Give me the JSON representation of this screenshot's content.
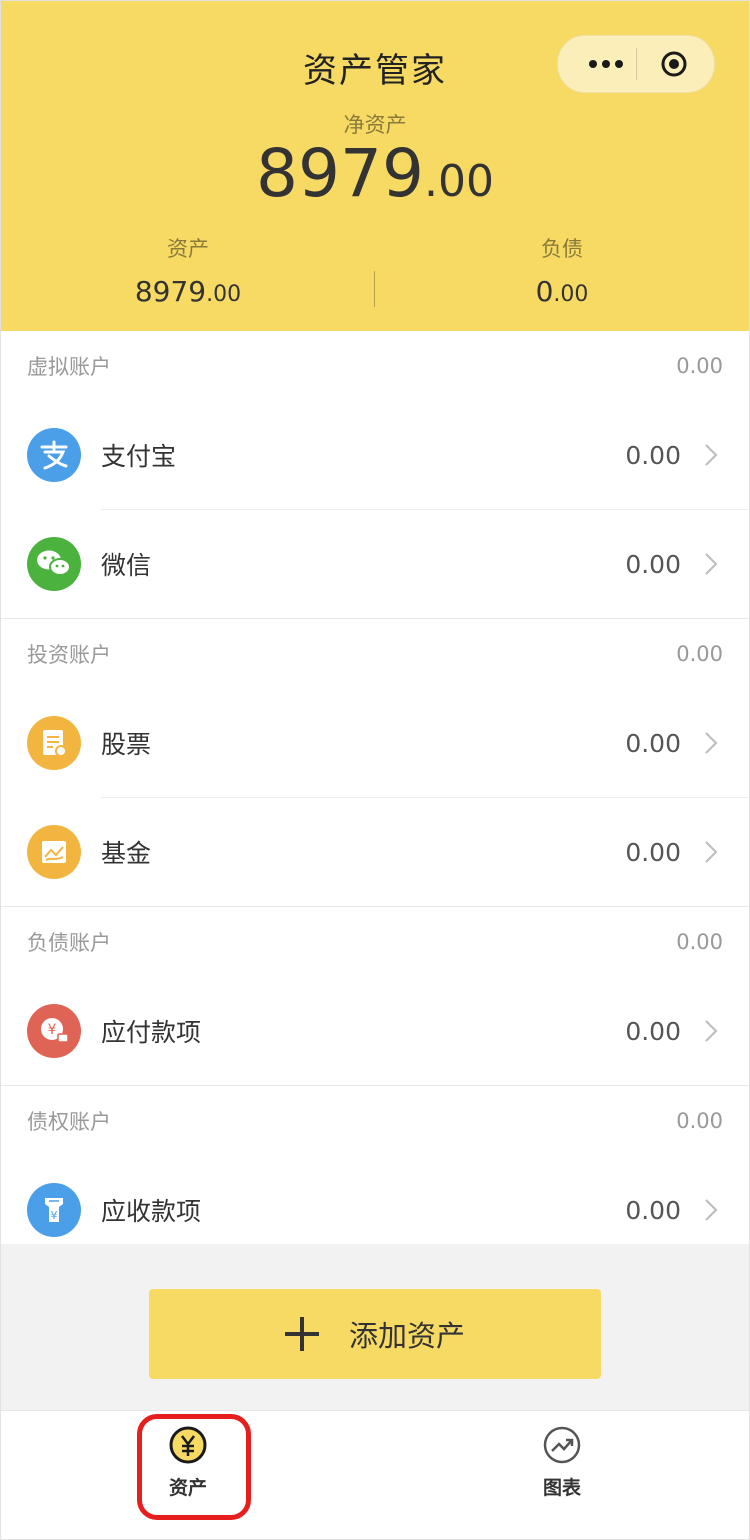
{
  "header": {
    "title": "资产管家",
    "net_assets_label": "净资产",
    "net_assets_int": "8979",
    "net_assets_dec": ".00",
    "assets_label": "资产",
    "assets_int": "8979",
    "assets_dec": ".00",
    "liabilities_label": "负债",
    "liabilities_int": "0",
    "liabilities_dec": ".00",
    "more_icon": "more-dots-icon",
    "close_icon": "target-circle-icon"
  },
  "sections": [
    {
      "title": "虚拟账户",
      "total": "0.00",
      "items": [
        {
          "name": "支付宝",
          "value": "0.00",
          "icon": "alipay-icon",
          "color": "#4a9fe8"
        },
        {
          "name": "微信",
          "value": "0.00",
          "icon": "wechat-icon",
          "color": "#4bb33d"
        }
      ]
    },
    {
      "title": "投资账户",
      "total": "0.00",
      "items": [
        {
          "name": "股票",
          "value": "0.00",
          "icon": "stock-icon",
          "color": "#f2b53f"
        },
        {
          "name": "基金",
          "value": "0.00",
          "icon": "fund-icon",
          "color": "#f2b53f"
        }
      ]
    },
    {
      "title": "负债账户",
      "total": "0.00",
      "items": [
        {
          "name": "应付款项",
          "value": "0.00",
          "icon": "payable-icon",
          "color": "#e06456"
        }
      ]
    },
    {
      "title": "债权账户",
      "total": "0.00",
      "items": [
        {
          "name": "应收款项",
          "value": "0.00",
          "icon": "receivable-icon",
          "color": "#4a9fe8"
        }
      ]
    }
  ],
  "add_button": {
    "label": "添加资产",
    "icon": "plus-icon"
  },
  "tabbar": {
    "tabs": [
      {
        "label": "资产",
        "icon": "yuan-coin-icon",
        "active": true
      },
      {
        "label": "图表",
        "icon": "trend-chart-icon",
        "active": false
      }
    ]
  },
  "colors": {
    "brand_yellow": "#f7da64",
    "highlight_red": "#e61e1e"
  }
}
